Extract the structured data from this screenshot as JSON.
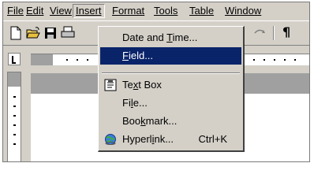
{
  "menubar": {
    "items": [
      {
        "label": "File"
      },
      {
        "label": "Edit"
      },
      {
        "label": "View"
      },
      {
        "label": "Insert",
        "open": true
      },
      {
        "label": "Format"
      },
      {
        "label": "Tools"
      },
      {
        "label": "Table"
      },
      {
        "label": "Window"
      }
    ]
  },
  "toolbar": {
    "icons": [
      "new-document-icon",
      "open-folder-icon",
      "save-icon",
      "print-icon",
      "undo-icon"
    ],
    "pilcrow": "¶"
  },
  "insert_menu": {
    "items": [
      {
        "pre": "Date and ",
        "key": "T",
        "post": "ime..."
      },
      {
        "pre": "",
        "key": "F",
        "post": "ield...",
        "highlighted": true
      },
      {
        "pre": "Te",
        "key": "x",
        "post": "t Box",
        "icon": "text-box-icon"
      },
      {
        "pre": "Fi",
        "key": "l",
        "post": "e..."
      },
      {
        "pre": "Boo",
        "key": "k",
        "post": "mark..."
      },
      {
        "pre": "Hyperl",
        "key": "i",
        "post": "nk...",
        "shortcut": "Ctrl+K",
        "icon": "hyperlink-globe-icon"
      }
    ]
  },
  "colors": {
    "chrome": "#d4d0c8",
    "highlight": "#0a246a",
    "highlight_text": "#ffffff"
  }
}
